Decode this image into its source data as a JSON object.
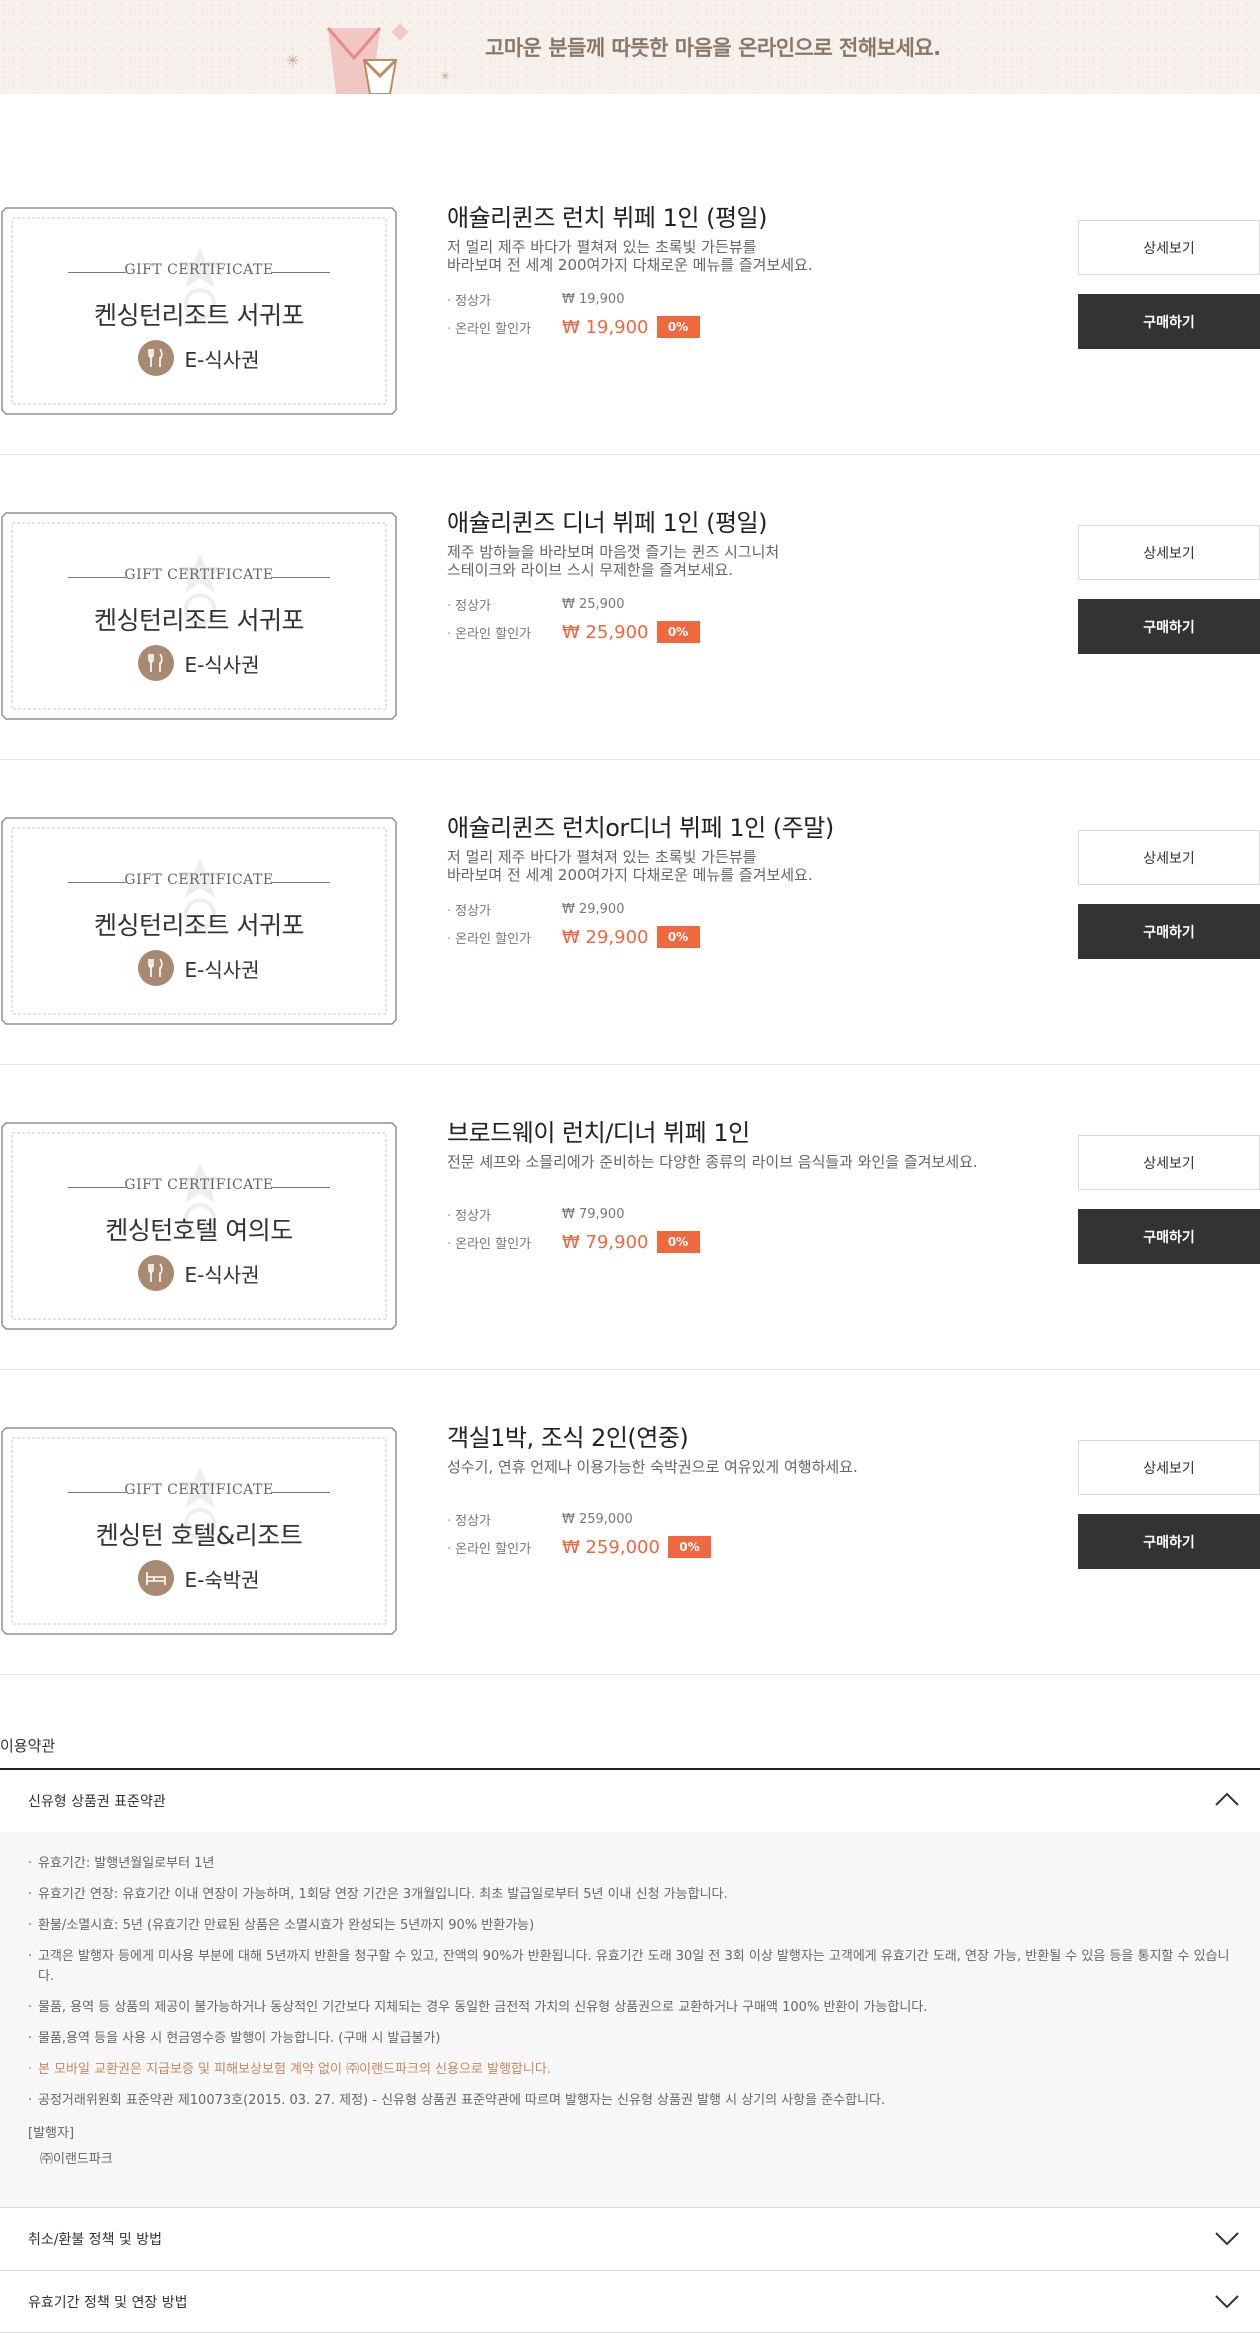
{
  "banner": {
    "text": "고마운 분들께 따뜻한 마음을 온라인으로 전해보세요."
  },
  "products": [
    {
      "cert_label": "GIFT CERTIFICATE",
      "cert_name": "켄싱턴리조트 서귀포",
      "cert_type": "E-식사권",
      "type_icon": "dining-icon",
      "title": "애슐리퀸즈 런치 뷔페 1인 (평일)",
      "desc": [
        "저 멀리 제주 바다가 펼쳐져 있는 초록빛 가든뷰를",
        "바라보며 전 세계 200여가지 다채로운 메뉴를 즐겨보세요."
      ],
      "regular_label": "정상가",
      "regular_price": "₩ 19,900",
      "sale_label": "온라인 할인가",
      "sale_price": "₩ 19,900",
      "discount": "0%",
      "detail_label": "상세보기",
      "buy_label": "구매하기"
    },
    {
      "cert_label": "GIFT CERTIFICATE",
      "cert_name": "켄싱턴리조트 서귀포",
      "cert_type": "E-식사권",
      "type_icon": "dining-icon",
      "title": "애슐리퀸즈 디너 뷔페 1인 (평일)",
      "desc": [
        "제주 밤하늘을 바라보며 마음껏 즐기는 퀸즈 시그니처",
        "스테이크와 라이브 스시 무제한을 즐겨보세요."
      ],
      "regular_label": "정상가",
      "regular_price": "₩ 25,900",
      "sale_label": "온라인 할인가",
      "sale_price": "₩ 25,900",
      "discount": "0%",
      "detail_label": "상세보기",
      "buy_label": "구매하기"
    },
    {
      "cert_label": "GIFT CERTIFICATE",
      "cert_name": "켄싱턴리조트 서귀포",
      "cert_type": "E-식사권",
      "type_icon": "dining-icon",
      "title": "애슐리퀸즈 런치or디너 뷔페 1인 (주말)",
      "desc": [
        "저 멀리 제주 바다가 펼쳐져 있는 초록빛 가든뷰를",
        "바라보며 전 세계 200여가지 다채로운 메뉴를 즐겨보세요."
      ],
      "regular_label": "정상가",
      "regular_price": "₩ 29,900",
      "sale_label": "온라인 할인가",
      "sale_price": "₩ 29,900",
      "discount": "0%",
      "detail_label": "상세보기",
      "buy_label": "구매하기"
    },
    {
      "cert_label": "GIFT CERTIFICATE",
      "cert_name": "켄싱턴호텔 여의도",
      "cert_type": "E-식사권",
      "type_icon": "dining-icon",
      "title": "브로드웨이 런치/디너 뷔페 1인",
      "desc": [
        "전문 셰프와 소믈리에가 준비하는 다양한 종류의 라이브 음식들과 와인을 즐겨보세요."
      ],
      "regular_label": "정상가",
      "regular_price": "₩ 79,900",
      "sale_label": "온라인 할인가",
      "sale_price": "₩ 79,900",
      "discount": "0%",
      "detail_label": "상세보기",
      "buy_label": "구매하기"
    },
    {
      "cert_label": "GIFT CERTIFICATE",
      "cert_name": "켄싱턴 호텔&리조트",
      "cert_type": "E-숙박권",
      "type_icon": "bed-icon",
      "title": "객실1박, 조식 2인(연중)",
      "desc": [
        "성수기, 연휴 언제나 이용가능한 숙박권으로 여유있게 여행하세요."
      ],
      "regular_label": "정상가",
      "regular_price": "₩ 259,000",
      "sale_label": "온라인 할인가",
      "sale_price": "₩ 259,000",
      "discount": "0%",
      "detail_label": "상세보기",
      "buy_label": "구매하기"
    }
  ],
  "terms": {
    "title": "이용약관",
    "sections": [
      {
        "label": "신유형 상품권 표준약관",
        "expanded": true,
        "icon": "chevron-up-icon"
      },
      {
        "label": "취소/환불 정책 및 방법",
        "expanded": false,
        "icon": "chevron-down-icon"
      },
      {
        "label": "유효기간 정책 및 연장 방법",
        "expanded": false,
        "icon": "chevron-down-icon"
      }
    ],
    "items": [
      "유효기간: 발행년월일로부터 1년",
      "유효기간 연장: 유효기간 이내 연장이 가능하며, 1회당 연장 기간은 3개월입니다. 최초 발급일로부터 5년 이내 신청 가능합니다.",
      "환불/소멸시효: 5년 (유효기간 만료된 상품은 소멸시효가 완성되는 5년까지 90% 반환가능)",
      "고객은 발행자 등에게 미사용 부분에 대해 5년까지 반환을 청구할 수 있고, 잔액의 90%가 반환됩니다. 유효기간 도래 30일 전 3회 이상 발행자는 고객에게 유효기간 도래, 연장 가능, 반환될 수 있음 등을 통지할 수 있습니다.",
      "물품, 용역 등 상품의 제공이 불가능하거나 동상적인 기간보다 지체되는 경우 동일한 금전적 가치의 신유형 상품권으로 교환하거나 구매액 100% 반환이 가능합니다.",
      "물품,용역 등을 사용 시 현금영수증 발행이 가능합니다. (구매 시 발급불가)",
      "본 모바일 교환권은 지급보증 및 피해보상보험 계약 없이 ㈜이랜드파크의 신용으로 발행합니다.",
      "공정거래위원회 표준약관 제10073호(2015. 03. 27. 제정) - 신유형 상품권 표준약관에 따르며 발행자는 신유형 상품권 발행 시 상기의 사항을 준수합니다."
    ],
    "issuer_label": "[발행자]",
    "issuer_name": "㈜이랜드파크"
  }
}
